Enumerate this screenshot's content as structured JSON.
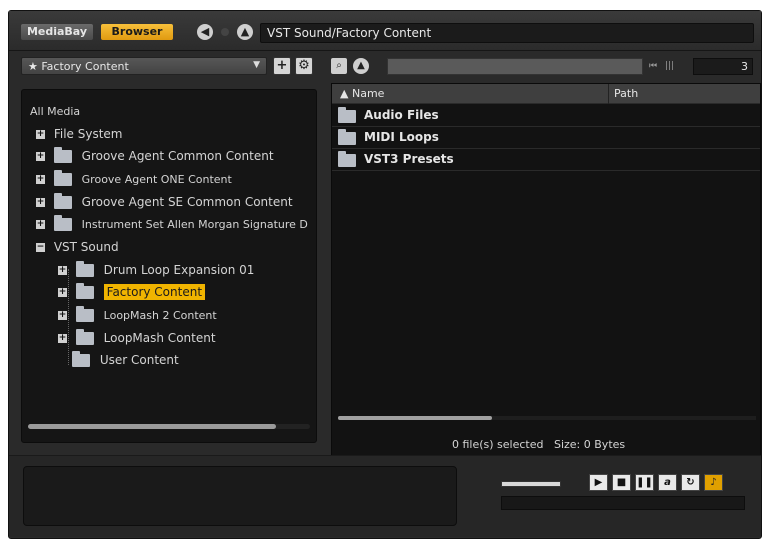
{
  "window": {
    "tabs": [
      {
        "label": "MediaBay",
        "active": false
      },
      {
        "label": "Browser",
        "active": true
      }
    ],
    "path": "VST Sound/Factory Content"
  },
  "colors": {
    "accent": "#f0b400",
    "background": "#2a2a2a",
    "panel": "#151515"
  },
  "left": {
    "favorite": "★ Factory Content",
    "tree": [
      {
        "label": "All Media",
        "level": 0,
        "toggle": ""
      },
      {
        "label": "File System",
        "level": 1,
        "toggle": "+",
        "folder": false
      },
      {
        "label": "Groove Agent Common Content",
        "level": 1,
        "toggle": "+",
        "folder": true
      },
      {
        "label": "Groove Agent ONE Content",
        "level": 1,
        "toggle": "+",
        "folder": true
      },
      {
        "label": "Groove Agent SE Common Content",
        "level": 1,
        "toggle": "+",
        "folder": true
      },
      {
        "label": "Instrument Set Allen Morgan Signature D",
        "level": 1,
        "toggle": "+",
        "folder": true
      },
      {
        "label": "VST Sound",
        "level": 1,
        "toggle": "−",
        "folder": false
      },
      {
        "label": "Drum Loop Expansion 01",
        "level": 2,
        "toggle": "+",
        "folder": true
      },
      {
        "label": "Factory Content",
        "level": 2,
        "toggle": "+",
        "folder": true,
        "selected": true
      },
      {
        "label": "LoopMash 2 Content",
        "level": 2,
        "toggle": "+",
        "folder": true
      },
      {
        "label": "LoopMash Content",
        "level": 2,
        "toggle": "+",
        "folder": true
      },
      {
        "label": "User Content",
        "level": 2,
        "toggle": "",
        "folder": true
      }
    ]
  },
  "right": {
    "count": "3",
    "columns": {
      "name": "Name",
      "path": "Path"
    },
    "rows": [
      {
        "name": "Audio Files",
        "path": ""
      },
      {
        "name": "MIDI Loops",
        "path": ""
      },
      {
        "name": "VST3 Presets",
        "path": ""
      }
    ],
    "status": "0 file(s) selected   Size: 0 Bytes"
  },
  "icons": {
    "back": "left-arrow-icon",
    "up": "up-arrow-icon",
    "add": "plus-icon",
    "settings": "gear-icon",
    "search": "search-icon"
  }
}
